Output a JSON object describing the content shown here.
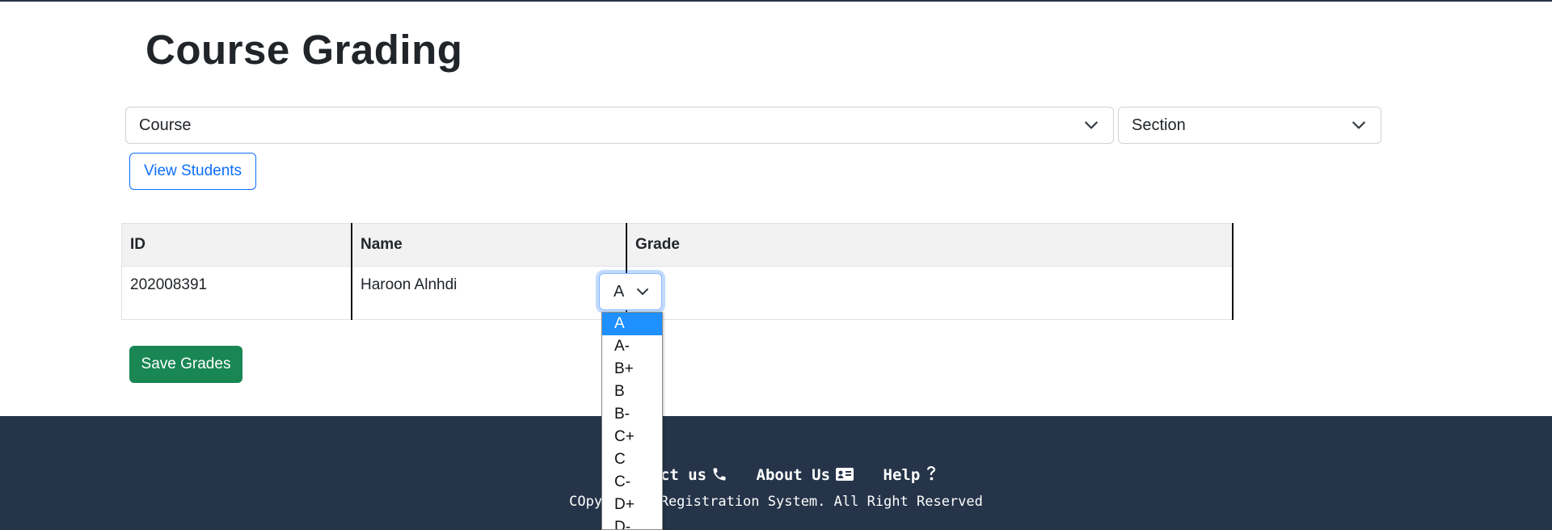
{
  "page": {
    "title": "Course Grading"
  },
  "filters": {
    "course": {
      "value": "Course"
    },
    "section": {
      "value": "Section"
    },
    "view_button": "View Students"
  },
  "table": {
    "headers": {
      "id": "ID",
      "name": "Name",
      "grade": "Grade"
    },
    "rows": [
      {
        "id": "202008391",
        "name": "Haroon Alnhdi",
        "grade": "A"
      }
    ]
  },
  "grade_dropdown": {
    "selected": "A",
    "options": [
      "A",
      "A-",
      "B+",
      "B",
      "B-",
      "C+",
      "C",
      "C-",
      "D+",
      "D-"
    ]
  },
  "save_button": "Save Grades",
  "footer": {
    "links": [
      {
        "label": "Contact us",
        "icon": "phone-icon"
      },
      {
        "label": "About Us",
        "icon": "id-card-icon"
      },
      {
        "label": "Help",
        "icon": "question-icon"
      }
    ],
    "copyright": "COpyriht © Registration System. All Right Reserved"
  },
  "colors": {
    "footer_bg": "#253449",
    "primary": "#0d6efd",
    "success": "#198754",
    "option_highlight": "#1e90ff"
  }
}
